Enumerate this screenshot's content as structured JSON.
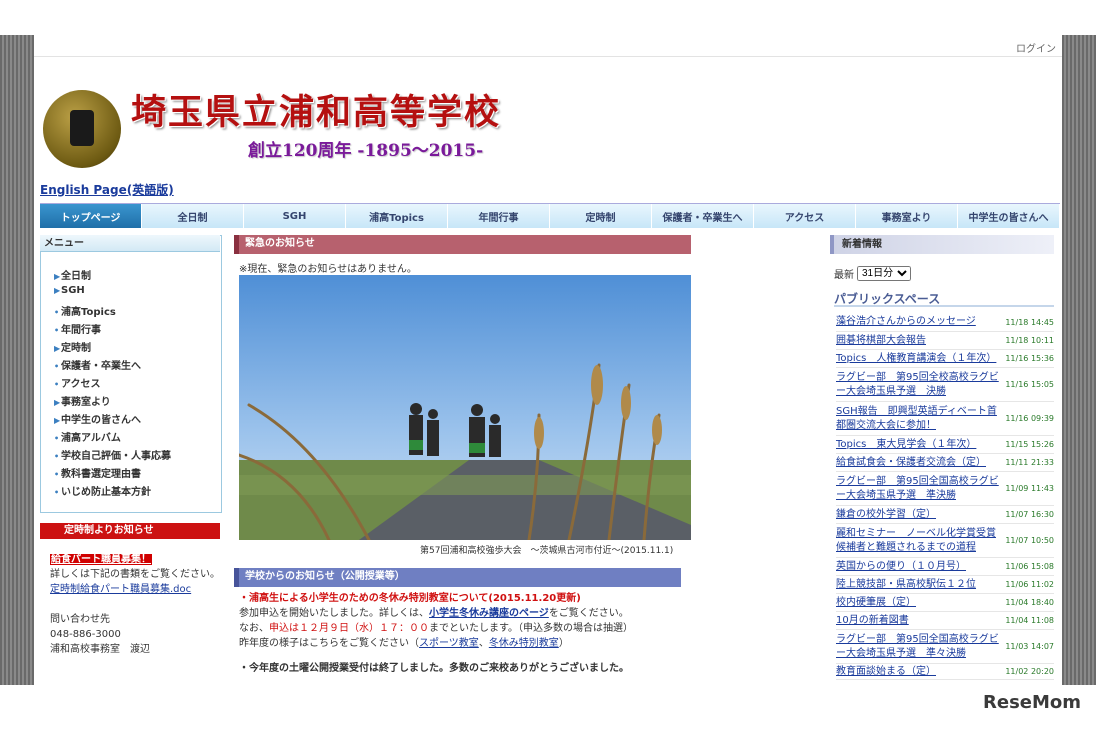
{
  "header": {
    "login": "ログイン",
    "school_name": "埼玉県立浦和高等学校",
    "anniversary": "創立120周年 -1895～2015-",
    "english_link": "English Page(英語版)"
  },
  "nav": [
    "トップページ",
    "全日制",
    "SGH",
    "浦高Topics",
    "年間行事",
    "定時制",
    "保護者・卒業生へ",
    "アクセス",
    "事務室より",
    "中学生の皆さんへ"
  ],
  "menu": {
    "title": "メニュー",
    "items": [
      {
        "mark": "▶",
        "label": "全日制"
      },
      {
        "mark": "▶",
        "label": "SGH"
      },
      {
        "mark": "•",
        "label": "浦高Topics"
      },
      {
        "mark": "•",
        "label": "年間行事"
      },
      {
        "mark": "▶",
        "label": "定時制"
      },
      {
        "mark": "•",
        "label": "保護者・卒業生へ"
      },
      {
        "mark": "•",
        "label": "アクセス"
      },
      {
        "mark": "▶",
        "label": "事務室より"
      },
      {
        "mark": "▶",
        "label": "中学生の皆さんへ"
      },
      {
        "mark": "•",
        "label": "浦高アルバム"
      },
      {
        "mark": "•",
        "label": "学校自己評価・人事応募"
      },
      {
        "mark": "•",
        "label": "教科書選定理由書"
      },
      {
        "mark": "•",
        "label": "いじめ防止基本方針"
      }
    ]
  },
  "teiji": {
    "title": "定時制よりお知らせ",
    "highlight": "給食パート職員募集！",
    "text": "詳しくは下記の書類をご覧ください。",
    "doc_link": "定時制給食パート職員募集.doc",
    "contact_label": "問い合わせ先",
    "phone": "048-886-3000",
    "office": "浦和高校事務室　渡辺"
  },
  "emergency": {
    "title": "緊急のお知らせ",
    "text": "※現在、緊急のお知らせはありません。",
    "caption": "第57回浦和高校強歩大会　～茨城県古河市付近～(2015.11.1)"
  },
  "school_notice": {
    "title": "学校からのお知らせ（公開授業等）",
    "headline": "・浦高生による小学生のための冬休み特別教室について(2015.11.20更新)",
    "line1_pre": "参加申込を開始いたしました。詳しくは、",
    "line1_link": "小学生冬休み講座のページ",
    "line1_post": "をご覧ください。",
    "line2_pre": "なお、",
    "line2_red": "申込は１２月９日（水）１７：００",
    "line2_post": "までといたします。（申込多数の場合は抽選）",
    "line3_pre": "昨年度の様子はこちらをご覧ください（",
    "line3_link1": "スポーツ教室",
    "line3_sep": "、",
    "line3_link2": "冬休み特別教室",
    "line3_post": "）",
    "line4": "・今年度の土曜公開授業受付は終了しました。多数のご来校ありがとうございました。"
  },
  "new_info": {
    "title": "新着情報",
    "latest_label": "最新",
    "latest_value": "31日分",
    "public_space": "パブリックスペース",
    "items": [
      {
        "title": "藻谷浩介さんからのメッセージ",
        "time": "11/18 14:45"
      },
      {
        "title": "囲碁将棋部大会報告",
        "time": "11/18 10:11"
      },
      {
        "title": "Topics　人権教育講演会（１年次）",
        "time": "11/16 15:36"
      },
      {
        "title": "ラグビー部　第95回全校高校ラグビー大会埼玉県予選　決勝",
        "time": "11/16 15:05"
      },
      {
        "title": "SGH報告　即興型英語ディベート首都圏交流大会に参加！",
        "time": "11/16 09:39"
      },
      {
        "title": "Topics　東大見学会（１年次）",
        "time": "11/15 15:26"
      },
      {
        "title": "給食試食会・保護者交流会（定）",
        "time": "11/11 21:33"
      },
      {
        "title": "ラグビー部　第95回全国高校ラグビー大会埼玉県予選　準決勝",
        "time": "11/09 11:43"
      },
      {
        "title": "鎌倉の校外学習（定）",
        "time": "11/07 16:30"
      },
      {
        "title": "麗和セミナー　ノーベル化学賞受賞候補者と難題されるまでの道程",
        "time": "11/07 10:50"
      },
      {
        "title": "英国からの便り（１０月号）",
        "time": "11/06 15:08"
      },
      {
        "title": "陸上競技部・県高校駅伝１２位",
        "time": "11/06 11:02"
      },
      {
        "title": "校内硬筆展（定）",
        "time": "11/04 18:40"
      },
      {
        "title": "10月の新着図書",
        "time": "11/04 11:08"
      },
      {
        "title": "ラグビー部　第95回全国高校ラグビー大会埼玉県予選　準々決勝",
        "time": "11/03 14:07"
      },
      {
        "title": "教育面談始まる（定）",
        "time": "11/02 20:20"
      }
    ]
  },
  "watermark": "ReseMom"
}
